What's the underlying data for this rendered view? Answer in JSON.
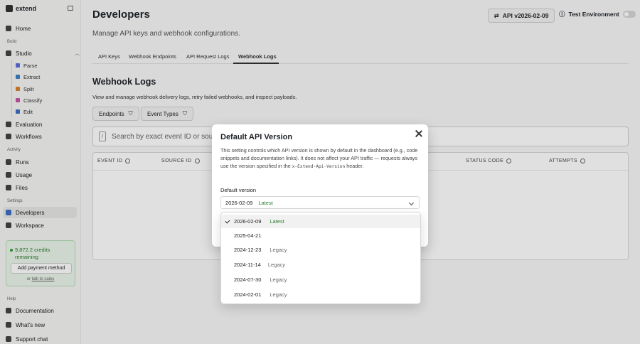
{
  "brand": {
    "name": "extend"
  },
  "sidebar": {
    "home": "Home",
    "section_build": "Build",
    "studio": "Studio",
    "studio_items": [
      "Parse",
      "Extract",
      "Split",
      "Classify",
      "Edit"
    ],
    "evaluation": "Evaluation",
    "workflows": "Workflows",
    "section_activity": "Activity",
    "runs": "Runs",
    "usage": "Usage",
    "files": "Files",
    "section_settings": "Settings",
    "developers": "Developers",
    "workspace": "Workspace",
    "credits_line1": "9,872.2 credits",
    "credits_line2": "remaining",
    "add_payment": "Add payment method",
    "sales_prefix": "or",
    "sales_link": "talk to sales",
    "section_help": "Help",
    "documentation": "Documentation",
    "whats_new": "What's new",
    "support_chat": "Support chat"
  },
  "header": {
    "title": "Developers",
    "subtitle": "Manage API keys and webhook configurations.",
    "api_version_btn": "API v2026-02-09",
    "test_env": "Test Environment"
  },
  "tabs": [
    {
      "label": "API Keys"
    },
    {
      "label": "Webhook Endpoints"
    },
    {
      "label": "API Request Logs"
    },
    {
      "label": "Webhook Logs"
    }
  ],
  "section": {
    "title": "Webhook Logs",
    "subtitle": "View and manage webhook delivery logs, retry failed webhooks, and inspect payloads.",
    "filter_endpoints": "Endpoints",
    "filter_event_types": "Event Types",
    "search_placeholder": "Search by exact event ID or source ID",
    "slash": "/",
    "table_headers": [
      "EVENT ID",
      "SOURCE ID",
      "STATUS CODE",
      "ATTEMPTS"
    ]
  },
  "dialog": {
    "title": "Default API Version",
    "body_prefix": "This setting controls which API version is shown by default in the dashboard (e.g., code snippets and documentation links). It does not affect your API traffic — requests always use the version specified in the",
    "body_code": "x-Extend-Api-Version",
    "body_suffix": "header.",
    "field_label": "Default version",
    "selected_value": "2026-02-09",
    "selected_tag": "Latest"
  },
  "dropdown": {
    "options": [
      {
        "value": "2026-02-09",
        "tag": "Latest",
        "selected": true
      },
      {
        "value": "2025-04-21",
        "tag": "",
        "selected": false
      },
      {
        "value": "2024-12-23",
        "tag": "Legacy",
        "selected": false
      },
      {
        "value": "2024-11-14",
        "tag": "Legacy",
        "selected": false
      },
      {
        "value": "2024-07-30",
        "tag": "Legacy",
        "selected": false
      },
      {
        "value": "2024-02-01",
        "tag": "Legacy",
        "selected": false
      }
    ]
  },
  "colors": {
    "accent_green": "#2e7d32",
    "active_nav": "#e7e7e6"
  }
}
